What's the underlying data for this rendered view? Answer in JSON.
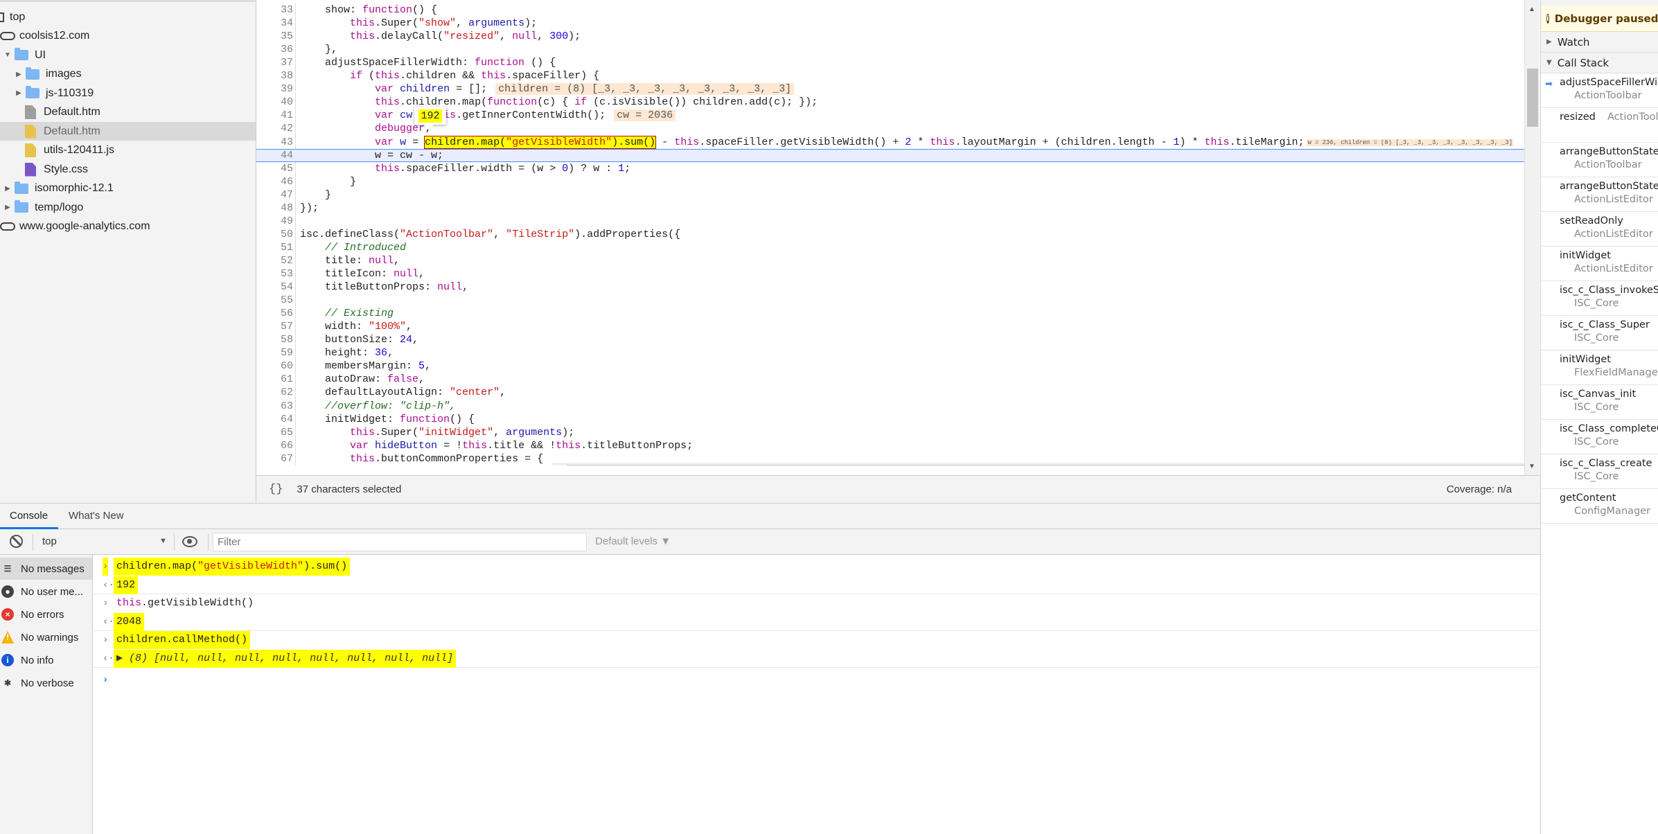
{
  "navigator": {
    "items": [
      {
        "label": "top",
        "icon": "frame-icon",
        "depth": 0
      },
      {
        "label": "coolsis12.com",
        "icon": "cloud-icon",
        "depth": 0
      },
      {
        "label": "UI",
        "icon": "folder-icon",
        "depth": 1,
        "expanded": true
      },
      {
        "label": "images",
        "icon": "folder-icon",
        "depth": 2,
        "expanded": false
      },
      {
        "label": "js-110319",
        "icon": "folder-icon",
        "depth": 2,
        "expanded": false
      },
      {
        "label": "Default.htm",
        "icon": "file-icon",
        "depth": 2,
        "color": "#9e9e9e"
      },
      {
        "label": "Default.htm",
        "icon": "file-icon",
        "depth": 2,
        "color": "#e6c34d",
        "selected": true
      },
      {
        "label": "utils-120411.js",
        "icon": "file-icon",
        "depth": 2,
        "color": "#e6c34d"
      },
      {
        "label": "Style.css",
        "icon": "file-icon",
        "depth": 2,
        "color": "#7b55c8"
      },
      {
        "label": "isomorphic-12.1",
        "icon": "folder-icon",
        "depth": 1,
        "expanded": false
      },
      {
        "label": "temp/logo",
        "icon": "folder-icon",
        "depth": 1,
        "expanded": false
      },
      {
        "label": "www.google-analytics.com",
        "icon": "cloud-icon",
        "depth": 0
      }
    ]
  },
  "editor": {
    "first_line": 33,
    "current_line": 44,
    "selection": {
      "line": 43,
      "text": "children.map(\"getVisibleWidth\").sum()"
    },
    "hover_value": "192",
    "lines": [
      "    show: function() {",
      "        this.Super(\"show\", arguments);",
      "        this.delayCall(\"resized\", null, 300);",
      "    },",
      "    adjustSpaceFillerWidth: function () {",
      "        if (this.children && this.spaceFiller) {",
      "            var children = [];",
      "            this.children.map(function(c) { if (c.isVisible()) children.add(c); });",
      "            var cw = this.getInnerContentWidth();",
      "            debugger;",
      "            var w = children.map(\"getVisibleWidth\").sum() - this.spaceFiller.getVisibleWidth() + 2 * this.layoutMargin + (children.length - 1) * this.tileMargin;",
      "            w = cw - w;",
      "            this.spaceFiller.width = (w > 0) ? w : 1;",
      "        }",
      "    }",
      "});",
      "",
      "isc.defineClass(\"ActionToolbar\", \"TileStrip\").addProperties({",
      "    // Introduced",
      "    title: null,",
      "    titleIcon: null,",
      "    titleButtonProps: null,",
      "",
      "    // Existing",
      "    width: \"100%\",",
      "    buttonSize: 24,",
      "    height: 36,",
      "    membersMargin: 5,",
      "    autoDraw: false,",
      "    defaultLayoutAlign: \"center\",",
      "    //overflow: \"clip-h\",",
      "    initWidget: function() {",
      "        this.Super(\"initWidget\", arguments);",
      "        var hideButton = !this.title && !this.titleButtonProps;",
      "        this.buttonCommonProperties = {",
      ""
    ],
    "inline_values": {
      "39": "children = (8) [_3, _3, _3, _3, _3, _3, _3, _3]",
      "41": "cw = 2036",
      "43": "w = 236, children = (8) [_3, _3, _3, _3, _3, _3, _3, _3]"
    }
  },
  "status_bar": {
    "format_icon": "{}",
    "selection_info": "37 characters selected",
    "coverage": "Coverage: n/a"
  },
  "debugger": {
    "banner": "Debugger paused",
    "watch_label": "Watch",
    "call_stack_label": "Call Stack",
    "frames": [
      {
        "name": "adjustSpaceFillerWidth",
        "location": "ActionToolbar",
        "current": true
      },
      {
        "name": "resized",
        "location": "ActionToolbar",
        "inline": true
      },
      {
        "name": "arrangeButtonStates",
        "location": "ActionToolbar"
      },
      {
        "name": "arrangeButtonStates",
        "location": "ActionListEditor"
      },
      {
        "name": "setReadOnly",
        "location": "ActionListEditor"
      },
      {
        "name": "initWidget",
        "location": "ActionListEditor"
      },
      {
        "name": "isc_c_Class_invokeSuper",
        "location": "ISC_Core"
      },
      {
        "name": "isc_c_Class_Super",
        "location": "ISC_Core"
      },
      {
        "name": "initWidget",
        "location": "FlexFieldManager"
      },
      {
        "name": "isc_Canvas_init",
        "location": "ISC_Core"
      },
      {
        "name": "isc_Class_completeCreation",
        "location": "ISC_Core"
      },
      {
        "name": "isc_c_Class_create",
        "location": "ISC_Core"
      },
      {
        "name": "getContent",
        "location": "ConfigManager"
      }
    ]
  },
  "drawer": {
    "tabs": [
      {
        "label": "Console",
        "active": true
      },
      {
        "label": "What's New"
      }
    ],
    "context": "top",
    "filter_placeholder": "Filter",
    "levels": "Default levels ▼",
    "sidebar": [
      {
        "label": "No messages",
        "icon": "list-icon",
        "selected": true
      },
      {
        "label": "No user me...",
        "icon": "user-icon"
      },
      {
        "label": "No errors",
        "icon": "error-icon"
      },
      {
        "label": "No warnings",
        "icon": "warning-icon"
      },
      {
        "label": "No info",
        "icon": "info-icon"
      },
      {
        "label": "No verbose",
        "icon": "bug-icon"
      }
    ],
    "messages": [
      {
        "kind": "input",
        "text": "children.map(\"getVisibleWidth\").sum()",
        "highlight": true
      },
      {
        "kind": "output",
        "text": "192",
        "highlight": true
      },
      {
        "kind": "input",
        "text": "this.getVisibleWidth()"
      },
      {
        "kind": "output",
        "text": "2048",
        "highlight": true
      },
      {
        "kind": "input",
        "text": "children.callMethod()",
        "highlight": true
      },
      {
        "kind": "output",
        "text": "▶ (8) [null, null, null, null, null, null, null, null]",
        "highlight": true,
        "italic": true
      }
    ]
  },
  "colors": {
    "keyword": "#aa0d91",
    "string": "#c41a16",
    "number": "#1c00cf",
    "comment": "#236e25",
    "highlight": "#ffff00",
    "accent": "#1a73e8"
  }
}
